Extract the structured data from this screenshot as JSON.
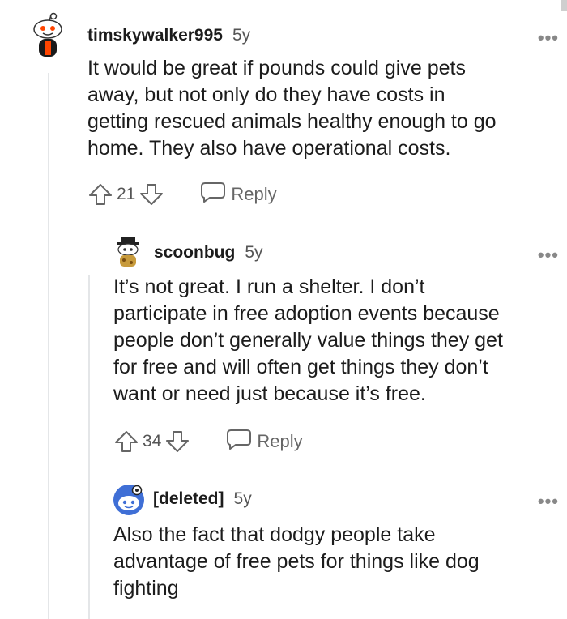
{
  "comments": [
    {
      "username": "timskywalker995",
      "age": "5y",
      "more": "•••",
      "body": "It would be great if pounds could give pets\naway, but not only do they have costs in\ngetting rescued animals healthy enough to go\nhome. They also have operational costs.",
      "score": "21",
      "reply_label": "Reply"
    },
    {
      "username": "scoonbug",
      "age": "5y",
      "more": "•••",
      "body": "It’s not great. I run a shelter. I don’t\nparticipate in free adoption events because\npeople don’t generally value things they get\nfor free and will often get things they don’t\nwant or need just because it’s free.",
      "score": "34",
      "reply_label": "Reply"
    },
    {
      "username": "[deleted]",
      "age": "5y",
      "more": "•••",
      "body": "Also the fact that dodgy people take\nadvantage of free pets for things like dog\nfighting"
    }
  ],
  "colors": {
    "accent": "#ff4500",
    "muted": "#666666",
    "thread_line": "#e4e6e8"
  }
}
